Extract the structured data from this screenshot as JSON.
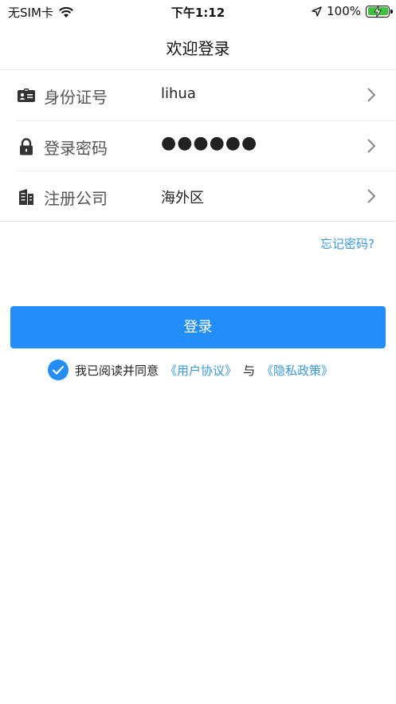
{
  "status_bar": {
    "carrier": "无SIM卡",
    "time": "下午1:12",
    "battery": "100%"
  },
  "nav": {
    "title": "欢迎登录"
  },
  "form": {
    "rows": [
      {
        "label": "身份证号",
        "value": "lihua",
        "icon": "id-card-icon"
      },
      {
        "label": "登录密码",
        "value": "●●●●●●",
        "icon": "lock-icon"
      },
      {
        "label": "注册公司",
        "value": "海外区",
        "icon": "building-icon"
      }
    ]
  },
  "forgot_password": "忘记密码?",
  "login_button": "登录",
  "agreement": {
    "prefix": "我已阅读并同意",
    "user_agreement": "《用户协议》",
    "joiner": "与",
    "privacy_policy": "《隐私政策》",
    "checked": true
  },
  "colors": {
    "accent": "#238ef7",
    "link": "#3a98d8"
  }
}
